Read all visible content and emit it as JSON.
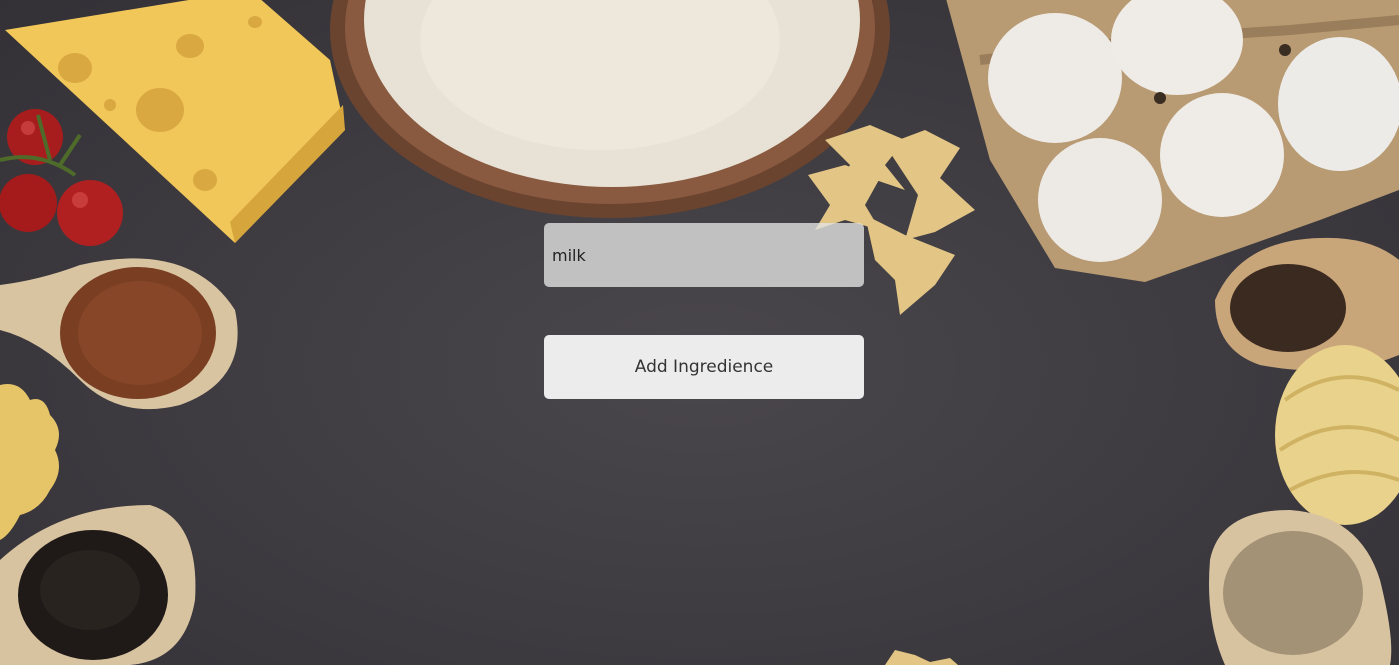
{
  "form": {
    "ingredient_value": "milk",
    "ingredient_placeholder": "",
    "add_button_label": "Add Ingredience"
  },
  "colors": {
    "background": "#3d3b40",
    "input_background": "#e1e1e1",
    "button_background": "#ececec"
  },
  "background": {
    "decorations": [
      "cheese",
      "cherry-tomatoes",
      "flour-bowl",
      "eggs-carton",
      "farfalle-pasta",
      "spice-spoon",
      "pepper-spoon",
      "fusilli-pasta",
      "tagliatelle-nest",
      "ground-spice-spoon"
    ]
  }
}
